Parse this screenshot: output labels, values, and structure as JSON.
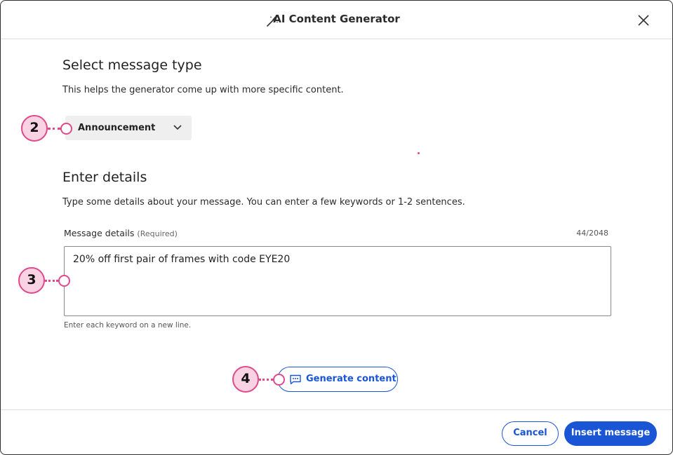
{
  "dialog": {
    "title": "AI Content Generator",
    "icons": {
      "title_icon": "magic-wand-icon",
      "close": "close-icon"
    }
  },
  "message_type": {
    "heading": "Select message type",
    "description": "This helps the generator come up with more specific content.",
    "selected": "Announcement"
  },
  "details": {
    "heading": "Enter details",
    "description": "Type some details about your message. You can enter a few keywords or 1-2 sentences.",
    "field_label": "Message details",
    "required_label": "(Required)",
    "counter": "44/2048",
    "value": "20% off first pair of frames with code EYE20",
    "hint": "Enter each keyword on a new line."
  },
  "actions": {
    "generate": "Generate content",
    "cancel": "Cancel",
    "insert": "Insert message"
  },
  "callouts": [
    "2",
    "3",
    "4"
  ],
  "colors": {
    "accent": "#1a55d6",
    "callout": "#e0498a",
    "callout_fill": "#f9d3e3"
  }
}
